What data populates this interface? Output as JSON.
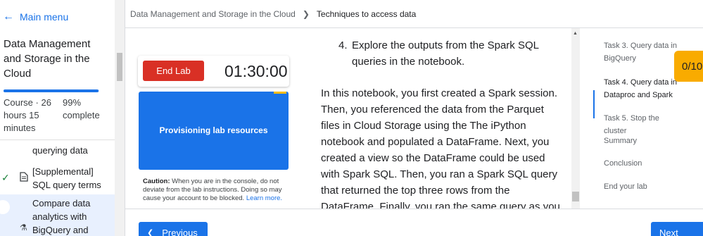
{
  "sidebar": {
    "main_menu": "Main menu",
    "course_title": "Data Management and Storage in the Cloud",
    "course_meta": "Course · 26 hours 15 minutes",
    "progress_pct": 99,
    "progress_text": "99% complete",
    "partial_item": "querying data",
    "items": [
      {
        "label": "[Supplemental] SQL query terms",
        "status": "completed",
        "icon": "document-icon"
      },
      {
        "label": "Compare data analytics with BigQuery and",
        "status": "current",
        "icon": "flask-icon"
      }
    ]
  },
  "breadcrumb": {
    "course": "Data Management and Storage in the Cloud",
    "current": "Techniques to access data"
  },
  "lab": {
    "end_label": "End Lab",
    "timer": "01:30:00",
    "provisioning": "Provisioning lab resources",
    "caution_label": "Caution:",
    "caution_text": " When you are in the console, do not deviate from the lab instructions. Doing so may cause your account to be blocked. ",
    "learn_more": "Learn more."
  },
  "content": {
    "step_number": "4.",
    "step_text": "Explore the outputs from the Spark SQL queries in the notebook.",
    "paragraph": "In this notebook, you first created a Spark session. Then, you referenced the data from the Parquet files in Cloud Storage using the The iPython notebook and populated a DataFrame. Next, you created a view so the DataFrame could be used with Spark SQL. Then, you ran a Spark SQL query that returned the top three rows from the DataFrame. Finally, you ran the same query as you"
  },
  "outline": {
    "items": [
      {
        "label": "Task 3. Query data in BigQuery",
        "active": false
      },
      {
        "label": "Task 4. Query data in Dataproc and Spark",
        "active": true
      },
      {
        "label": "Task 5. Stop the cluster",
        "active": false
      },
      {
        "label": "Summary",
        "active": false
      },
      {
        "label": "Conclusion",
        "active": false
      },
      {
        "label": "End your lab",
        "active": false
      }
    ],
    "score": "0/10"
  },
  "nav": {
    "previous": "Previous",
    "next": "Next"
  },
  "colors": {
    "accent": "#1a73e8",
    "danger": "#d93025",
    "score": "#f9ab00",
    "success": "#188038"
  }
}
